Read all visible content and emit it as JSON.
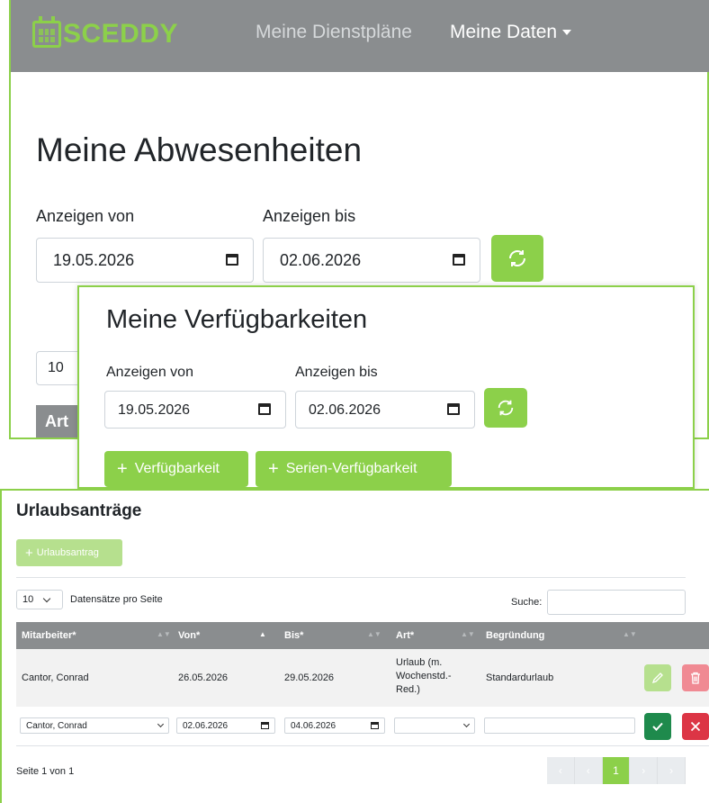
{
  "navbar": {
    "brand": "SCEDDY",
    "links": [
      {
        "label": "Meine Dienstpläne",
        "active": false
      },
      {
        "label": "Meine Daten",
        "active": true
      }
    ]
  },
  "absences": {
    "title": "Meine Abwesenheiten",
    "from_label": "Anzeigen von",
    "to_label": "Anzeigen bis",
    "from_value": "19.05.2026",
    "to_value": "02.06.2026",
    "page_length": "10",
    "table_first_header": "Art"
  },
  "availability": {
    "title": "Meine Verfügbarkeiten",
    "from_label": "Anzeigen von",
    "to_label": "Anzeigen bis",
    "from_value": "19.05.2026",
    "to_value": "02.06.2026",
    "add_button": "Verfügbarkeit",
    "add_series_button": "Serien-Verfügbarkeit"
  },
  "vacation": {
    "title": "Urlaubsanträge",
    "add_button": "Urlaubsantrag",
    "length_value": "10",
    "length_label": "Datensätze pro Seite",
    "search_label": "Suche:",
    "columns": [
      "Mitarbeiter*",
      "Von*",
      "Bis*",
      "Art*",
      "Begründung"
    ],
    "rows": [
      {
        "employee": "Cantor, Conrad",
        "from": "26.05.2026",
        "to": "29.05.2026",
        "type": "Urlaub (m. Wochenstd.-Red.)",
        "reason": "Standardurlaub"
      }
    ],
    "new_row": {
      "employee": "Cantor, Conrad",
      "from": "02.06.2026",
      "to": "04.06.2026",
      "type": "",
      "reason": ""
    },
    "page_info": "Seite 1 von 1",
    "current_page": "1"
  },
  "colors": {
    "accent": "#8cd04a",
    "navbar": "#8a8d8f",
    "save": "#1e8a4c",
    "cancel": "#dc3545",
    "delete_light": "#f08a93"
  }
}
